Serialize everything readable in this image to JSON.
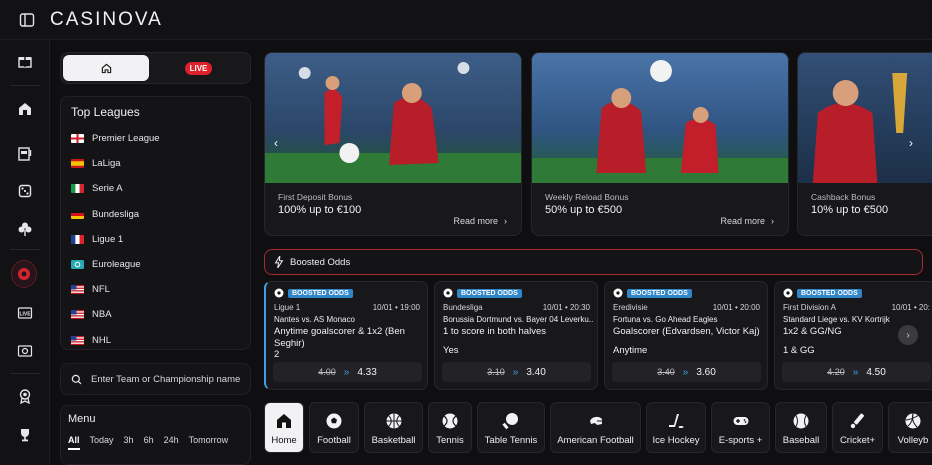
{
  "header": {
    "logo": "CASINOVA"
  },
  "rail": {
    "items": [
      {
        "name": "gift-icon"
      },
      {
        "name": "casino-icon"
      },
      {
        "name": "slot-icon"
      },
      {
        "name": "dice-icon"
      },
      {
        "name": "clover-icon"
      },
      {
        "name": "live-sports-icon"
      },
      {
        "name": "live-tv-icon",
        "label": "LIVE"
      },
      {
        "name": "casino-live-icon"
      },
      {
        "name": "badge-icon"
      },
      {
        "name": "trophy-icon"
      }
    ]
  },
  "panel": {
    "live_label": "LIVE",
    "leagues_title": "Top Leagues",
    "leagues": [
      {
        "name": "Premier League",
        "flag": "england"
      },
      {
        "name": "LaLiga",
        "flag": "spain"
      },
      {
        "name": "Serie A",
        "flag": "italy"
      },
      {
        "name": "Bundesliga",
        "flag": "germany"
      },
      {
        "name": "Ligue 1",
        "flag": "france"
      },
      {
        "name": "Euroleague",
        "flag": "euroleague"
      },
      {
        "name": "NFL",
        "flag": "usa"
      },
      {
        "name": "NBA",
        "flag": "usa"
      },
      {
        "name": "NHL",
        "flag": "usa"
      }
    ],
    "search_placeholder": "Enter Team or Championship name",
    "menu_title": "Menu",
    "menu_filters": [
      "All",
      "Today",
      "3h",
      "6h",
      "24h",
      "Tomorrow"
    ]
  },
  "promos": [
    {
      "subtitle": "First Deposit Bonus",
      "title": "100% up to €100",
      "read_more": "Read more"
    },
    {
      "subtitle": "Weekly Reload Bonus",
      "title": "50% up to €500",
      "read_more": "Read more"
    },
    {
      "subtitle": "Cashback Bonus",
      "title": "10% up to €500",
      "read_more": ""
    }
  ],
  "boosted": {
    "title": "Boosted Odds",
    "badge": "BOOSTED ODDS",
    "cards": [
      {
        "league": "Ligue 1",
        "time": "10/01 • 19:00",
        "match": "Nantes vs. AS Monaco",
        "market": "Anytime goalscorer & 1x2 (Ben Seghir)",
        "selection": "2",
        "old": "4.00",
        "new": "4.33"
      },
      {
        "league": "Bundesliga",
        "time": "10/01 • 20:30",
        "match": "Borussia Dortmund vs. Bayer 04 Leverku...",
        "market": "1 to score in both halves",
        "selection": "Yes",
        "old": "3.10",
        "new": "3.40"
      },
      {
        "league": "Eredivisie",
        "time": "10/01 • 20:00",
        "match": "Fortuna vs. Go Ahead Eagles",
        "market": "Goalscorer (Edvardsen, Victor Kaj)",
        "selection": "Anytime",
        "old": "3.40",
        "new": "3.60"
      },
      {
        "league": "First Division A",
        "time": "10/01 • 20:",
        "match": "Standard Liege vs. KV Kortrijk",
        "market": "1x2 & GG/NG",
        "selection": "1 & GG",
        "old": "4.20",
        "new": "4.50"
      }
    ]
  },
  "sports": [
    {
      "label": "Home",
      "icon": "home-icon"
    },
    {
      "label": "Football",
      "icon": "football-icon"
    },
    {
      "label": "Basketball",
      "icon": "basketball-icon"
    },
    {
      "label": "Tennis",
      "icon": "tennis-icon"
    },
    {
      "label": "Table Tennis",
      "icon": "table-tennis-icon"
    },
    {
      "label": "American Football",
      "icon": "american-football-icon"
    },
    {
      "label": "Ice Hockey",
      "icon": "ice-hockey-icon"
    },
    {
      "label": "E-sports +",
      "icon": "gamepad-icon"
    },
    {
      "label": "Baseball",
      "icon": "baseball-icon"
    },
    {
      "label": "Cricket+",
      "icon": "cricket-icon"
    },
    {
      "label": "Volleyb",
      "icon": "volleyball-icon"
    }
  ],
  "colors": {
    "accent_red": "#e0212c",
    "boost_blue": "#2f86c8",
    "bg": "#0f0f11",
    "card": "#18181b"
  }
}
